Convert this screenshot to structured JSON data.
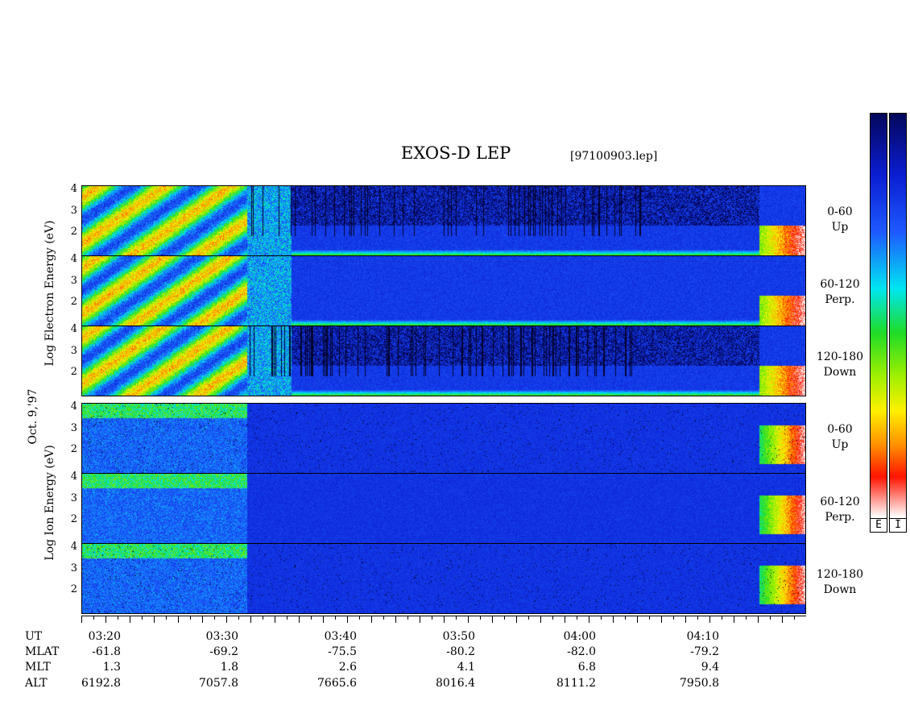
{
  "title": "EXOS-D LEP",
  "file_label": "[97100903.lep]",
  "date_label": "Oct. 9,'97",
  "electron_axis_label": "Log  Electron  Energy  (eV)",
  "ion_axis_label": "Log  Ion  Energy  (eV)",
  "y_ticks": [
    "4",
    "3",
    "2"
  ],
  "panels": [
    {
      "group": "electron",
      "pitch_label": "0-60",
      "dir_label": "Up"
    },
    {
      "group": "electron",
      "pitch_label": "60-120",
      "dir_label": "Perp."
    },
    {
      "group": "electron",
      "pitch_label": "120-180",
      "dir_label": "Down"
    },
    {
      "group": "ion",
      "pitch_label": "0-60",
      "dir_label": "Up"
    },
    {
      "group": "ion",
      "pitch_label": "60-120",
      "dir_label": "Perp."
    },
    {
      "group": "ion",
      "pitch_label": "120-180",
      "dir_label": "Down"
    }
  ],
  "colorbar_labels": [
    "E",
    "I"
  ],
  "colors": {
    "bg_low": "#0a1fd0",
    "dark": "#000000",
    "colormap_top": "#0a0a60",
    "colormap_bottom": "#ffffff"
  },
  "footer": {
    "row_labels": [
      "UT",
      "MLAT",
      "MLT",
      "ALT"
    ],
    "columns": [
      {
        "UT": "03:20",
        "MLAT": "-61.8",
        "MLT": "1.3",
        "ALT": "6192.8"
      },
      {
        "UT": "03:30",
        "MLAT": "-69.2",
        "MLT": "1.8",
        "ALT": "7057.8"
      },
      {
        "UT": "03:40",
        "MLAT": "-75.5",
        "MLT": "2.6",
        "ALT": "7665.6"
      },
      {
        "UT": "03:50",
        "MLAT": "-80.2",
        "MLT": "4.1",
        "ALT": "8016.4"
      },
      {
        "UT": "04:00",
        "MLAT": "-82.0",
        "MLT": "6.8",
        "ALT": "8111.2"
      },
      {
        "UT": "04:10",
        "MLAT": "-79.2",
        "MLT": "9.4",
        "ALT": "7950.8"
      }
    ]
  },
  "chart_data": {
    "type": "heatmap",
    "title": "EXOS-D LEP",
    "subtitle": "[97100903.lep]",
    "x_start": "03:18",
    "x_end": "04:18",
    "x_ticks": [
      "03:20",
      "03:30",
      "03:40",
      "03:50",
      "04:00",
      "04:10"
    ],
    "y_range": [
      1.0,
      4.2
    ],
    "y_ticks": [
      2,
      3,
      4
    ],
    "ylabel_electron": "Log Electron Energy (eV)",
    "ylabel_ion": "Log Ion Energy (eV)",
    "panels": [
      {
        "species": "electron",
        "pitch": "0-60",
        "direction": "Up"
      },
      {
        "species": "electron",
        "pitch": "60-120",
        "direction": "Perp."
      },
      {
        "species": "electron",
        "pitch": "120-180",
        "direction": "Down"
      },
      {
        "species": "ion",
        "pitch": "0-60",
        "direction": "Up"
      },
      {
        "species": "ion",
        "pitch": "60-120",
        "direction": "Perp."
      },
      {
        "species": "ion",
        "pitch": "120-180",
        "direction": "Down"
      }
    ]
  }
}
